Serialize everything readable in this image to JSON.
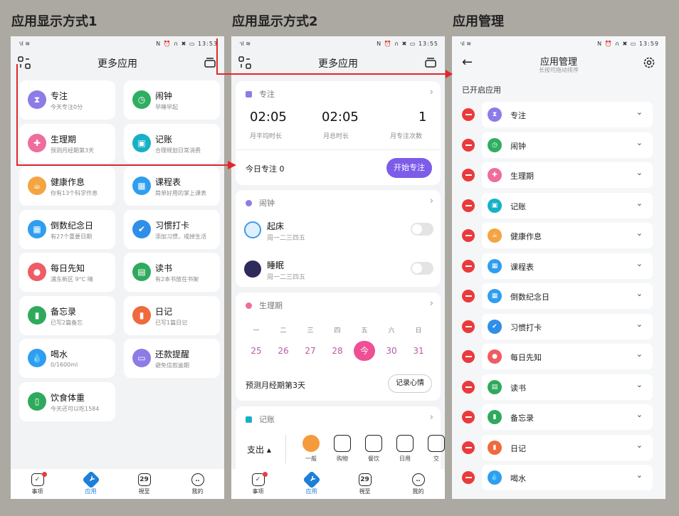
{
  "panel_titles": [
    "应用显示方式1",
    "应用显示方式2",
    "应用管理"
  ],
  "status": {
    "p1_time": "13:53",
    "p2_time": "13:55",
    "p3_time": "13:59",
    "signal": "ⁱıl ≋",
    "icons": "N ⏰ ∩ ✖ ▭"
  },
  "screen1": {
    "title": "更多应用",
    "cards": [
      {
        "title": "专注",
        "sub": "今天专注0分",
        "color": "#8d7be6",
        "glyph": "⧗"
      },
      {
        "title": "闹钟",
        "sub": "早睡早起",
        "color": "#2fae62",
        "glyph": "◷"
      },
      {
        "title": "生理期",
        "sub": "预测月经期第3天",
        "color": "#ee6c9e",
        "glyph": "✚"
      },
      {
        "title": "记账",
        "sub": "合理规划日常消费",
        "color": "#16b1c6",
        "glyph": "▣"
      },
      {
        "title": "健康作息",
        "sub": "你有13个科学作息",
        "color": "#f5a442",
        "glyph": "☕"
      },
      {
        "title": "课程表",
        "sub": "简单好用的掌上课表",
        "color": "#2f9ef0",
        "glyph": "▦"
      },
      {
        "title": "倒数纪念日",
        "sub": "有27个重要日期",
        "color": "#2f9ef0",
        "glyph": "▦"
      },
      {
        "title": "习惯打卡",
        "sub": "添加习惯，戒掉生活",
        "color": "#2f8ee8",
        "glyph": "✔"
      },
      {
        "title": "每日先知",
        "sub": "浦东新区 9°C 晴",
        "color": "#ef5c63",
        "glyph": "●"
      },
      {
        "title": "读书",
        "sub": "有2本书放在书架",
        "color": "#2faa5c",
        "glyph": "▤"
      },
      {
        "title": "备忘录",
        "sub": "已写2篇备忘",
        "color": "#2faa5c",
        "glyph": "▮"
      },
      {
        "title": "日记",
        "sub": "已写1篇日记",
        "color": "#ef6a3c",
        "glyph": "▮"
      },
      {
        "title": "喝水",
        "sub": "0/1600ml",
        "color": "#2f9ef0",
        "glyph": "💧"
      },
      {
        "title": "还款提醒",
        "sub": "避免信款逾期",
        "color": "#8d7be6",
        "glyph": "▭"
      },
      {
        "title": "饮食体重",
        "sub": "今天还可以吃1584",
        "color": "#2faa5c",
        "glyph": "▯"
      }
    ]
  },
  "tabs": [
    {
      "label": "事项",
      "glyph": "✓"
    },
    {
      "label": "应用",
      "glyph": "Y"
    },
    {
      "label": "視至",
      "glyph": "29"
    },
    {
      "label": "我的",
      "glyph": "‥"
    }
  ],
  "screen2": {
    "title": "更多应用",
    "focus": {
      "header": "专注",
      "v1": "02:05",
      "l1": "月平均时长",
      "v2": "02:05",
      "l2": "月总时长",
      "v3": "1",
      "l3": "月专注次数",
      "today": "今日专注  0",
      "btn": "开始专注"
    },
    "alarm": {
      "header": "闹钟",
      "a1": "起床",
      "a1sub": "周一二三四五",
      "a2": "睡眠",
      "a2sub": "周一二三四五"
    },
    "period": {
      "header": "生理期",
      "week": [
        "一",
        "二",
        "三",
        "四",
        "五",
        "六",
        "日"
      ],
      "days": [
        "25",
        "26",
        "27",
        "28",
        "今",
        "30",
        "31"
      ],
      "forecast": "预测月经期第3天",
      "btn": "记录心情"
    },
    "account": {
      "header": "记账",
      "kind": "支出 ▴",
      "cats": [
        "一般",
        "购物",
        "餐饮",
        "日用",
        "交"
      ]
    }
  },
  "screen3": {
    "title": "应用管理",
    "subtitle": "长按可拖动排序",
    "section": "已开启应用",
    "rows": [
      {
        "label": "专注",
        "color": "#8d7be6",
        "glyph": "⧗"
      },
      {
        "label": "闹钟",
        "color": "#2fae62",
        "glyph": "◷"
      },
      {
        "label": "生理期",
        "color": "#ee6c9e",
        "glyph": "✚"
      },
      {
        "label": "记账",
        "color": "#16b1c6",
        "glyph": "▣"
      },
      {
        "label": "健康作息",
        "color": "#f5a442",
        "glyph": "☕"
      },
      {
        "label": "课程表",
        "color": "#2f9ef0",
        "glyph": "▦"
      },
      {
        "label": "倒数纪念日",
        "color": "#2f9ef0",
        "glyph": "▦"
      },
      {
        "label": "习惯打卡",
        "color": "#2f8ee8",
        "glyph": "✔"
      },
      {
        "label": "每日先知",
        "color": "#ef5c63",
        "glyph": "●"
      },
      {
        "label": "读书",
        "color": "#2faa5c",
        "glyph": "▤"
      },
      {
        "label": "备忘录",
        "color": "#2faa5c",
        "glyph": "▮"
      },
      {
        "label": "日记",
        "color": "#ef6a3c",
        "glyph": "▮"
      },
      {
        "label": "喝水",
        "color": "#2f9ef0",
        "glyph": "💧"
      }
    ]
  },
  "colors": {
    "accent": "#7c5ce8",
    "today": "#ee4f95",
    "delete": "#ea3a3b",
    "annotation": "#e3262a"
  }
}
